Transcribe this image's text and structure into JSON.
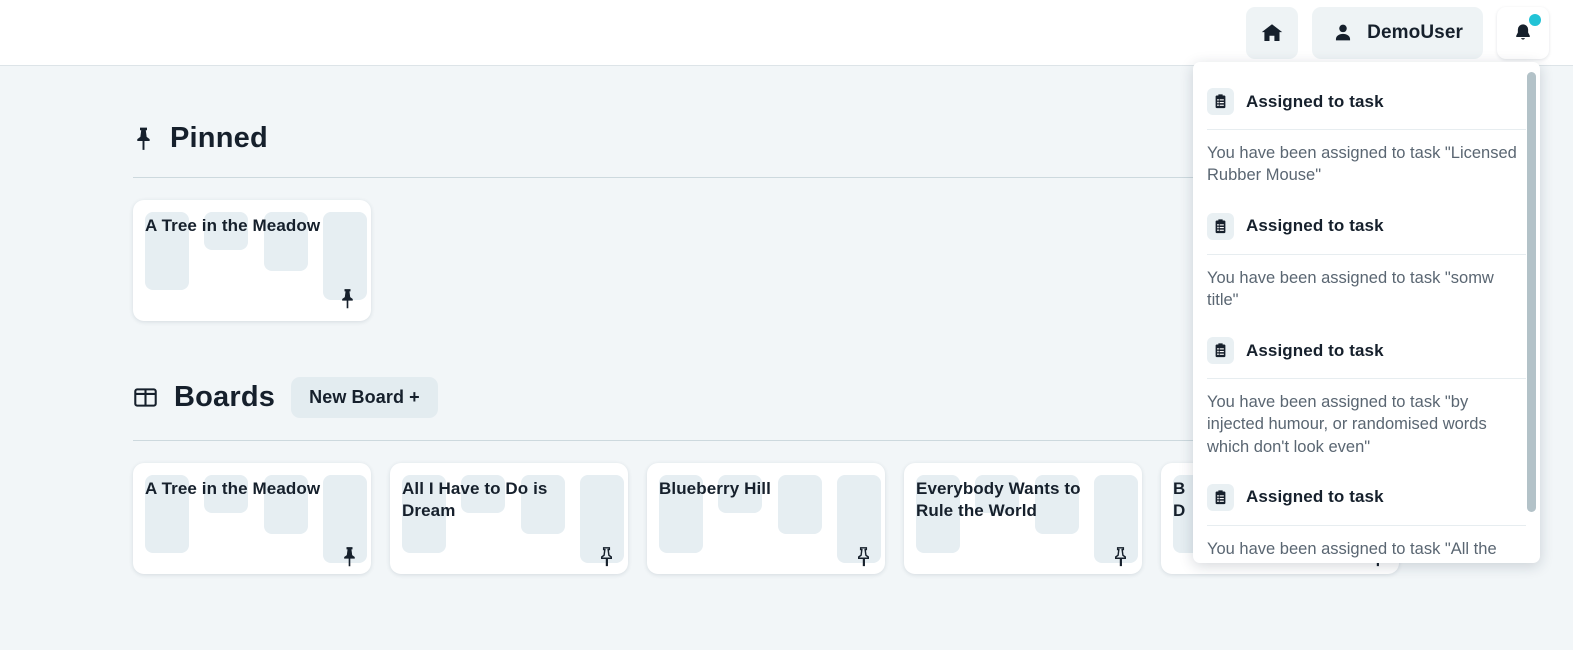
{
  "header": {
    "home_button": {
      "icon": "home-icon",
      "label": ""
    },
    "user_button": {
      "icon": "user-icon",
      "label": "DemoUser"
    },
    "bell_button": {
      "icon": "bell-icon",
      "has_unread_badge": true
    }
  },
  "colors": {
    "page_background": "#f2f6f8",
    "card_background": "#ffffff",
    "skeleton": "#e6eef2",
    "button_background": "#eef3f5",
    "badge_accent": "#22c3d6",
    "text_primary": "#16202c",
    "text_secondary": "#5a6672",
    "divider": "#cdd9de"
  },
  "pinned_section": {
    "icon": "pin-filled-icon",
    "title": "Pinned",
    "cards": [
      {
        "title": "A Tree in the Meadow",
        "pin_state": "pinned",
        "pin_icon": "pin-filled-icon"
      }
    ]
  },
  "boards_section": {
    "icon": "columns-layout-icon",
    "title": "Boards",
    "new_board_label": "New Board +",
    "cards": [
      {
        "title": "A Tree in the Meadow",
        "pin_state": "pinned",
        "pin_icon": "pin-filled-icon"
      },
      {
        "title": "All I Have to Do is Dream",
        "pin_state": "unpinned",
        "pin_icon": "pin-outline-icon"
      },
      {
        "title": "Blueberry Hill",
        "pin_state": "unpinned",
        "pin_icon": "pin-outline-icon"
      },
      {
        "title": "Everybody Wants to Rule the World",
        "pin_state": "unpinned",
        "pin_icon": "pin-outline-icon"
      },
      {
        "title": "B\nD",
        "pin_state": "unpinned",
        "pin_icon": "pin-outline-icon"
      }
    ]
  },
  "notifications": {
    "visible": true,
    "items": [
      {
        "icon": "clipboard-list-icon",
        "title": "Assigned to task",
        "body": "You have been assigned to task \"Licensed Rubber Mouse\""
      },
      {
        "icon": "clipboard-list-icon",
        "title": "Assigned to task",
        "body": "You have been assigned to task \"somw title\""
      },
      {
        "icon": "clipboard-list-icon",
        "title": "Assigned to task",
        "body": "You have been assigned to task \"by injected humour, or randomised words which don't look even\""
      },
      {
        "icon": "clipboard-list-icon",
        "title": "Assigned to task",
        "body": "You have been assigned to task \"All the Lorem Ipsum generators on the Internet"
      }
    ]
  }
}
